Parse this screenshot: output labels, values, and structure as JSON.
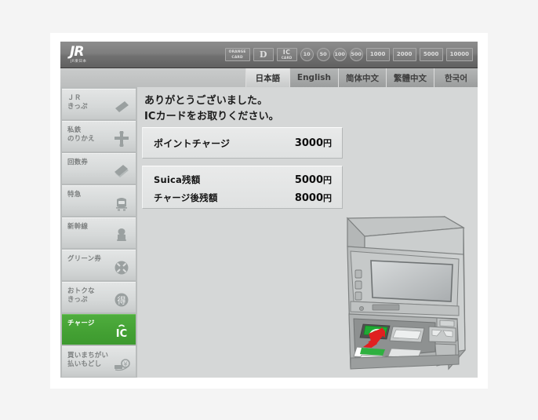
{
  "header": {
    "logo_mark": "JR",
    "logo_sub": "JR東日本",
    "badges": [
      {
        "name": "orange-card",
        "type": "two-line",
        "line1": "ORANGE",
        "line2": "CARD"
      },
      {
        "name": "d-card",
        "type": "dcard",
        "text": "D"
      },
      {
        "name": "ic-card",
        "type": "iccard",
        "line1": "IC",
        "line2": "CARD"
      },
      {
        "name": "coin-10",
        "type": "round",
        "text": "10"
      },
      {
        "name": "coin-50",
        "type": "round",
        "text": "50"
      },
      {
        "name": "coin-100",
        "type": "round",
        "text": "100"
      },
      {
        "name": "coin-500",
        "type": "round",
        "text": "500"
      },
      {
        "name": "note-1000",
        "type": "num",
        "text": "1000"
      },
      {
        "name": "note-2000",
        "type": "num",
        "text": "2000"
      },
      {
        "name": "note-5000",
        "type": "num",
        "text": "5000"
      },
      {
        "name": "note-10000",
        "type": "num",
        "text": "10000"
      }
    ]
  },
  "languages": [
    {
      "label": "日本語",
      "active": true
    },
    {
      "label": "English",
      "active": false
    },
    {
      "label": "简体中文",
      "active": false
    },
    {
      "label": "繁體中文",
      "active": false
    },
    {
      "label": "한국어",
      "active": false
    }
  ],
  "sidebar": {
    "items": [
      {
        "label": "ＪＲ\nきっぷ",
        "icon": "ticket-icon",
        "active": false
      },
      {
        "label": "私鉄\nのりかえ",
        "icon": "transfer-icon",
        "active": false
      },
      {
        "label": "回数券",
        "icon": "coupon-tickets-icon",
        "active": false
      },
      {
        "label": "特急",
        "icon": "limited-express-train-icon",
        "active": false
      },
      {
        "label": "新幹線",
        "icon": "shinkansen-icon",
        "active": false
      },
      {
        "label": "グリーン券",
        "icon": "green-car-icon",
        "active": false
      },
      {
        "label": "おトクな\nきっぷ",
        "icon": "discount-toku-icon",
        "active": false
      },
      {
        "label": "チャージ",
        "icon": "ic-logo-icon",
        "active": true
      },
      {
        "label": "買いまちがい\n払いもどし",
        "icon": "refund-icon",
        "active": false
      }
    ]
  },
  "main": {
    "message_line1": "ありがとうございました。",
    "message_line2": "ICカードをお取りください。",
    "point_charge": {
      "label": "ポイントチャージ",
      "value": "3000",
      "unit": "円"
    },
    "balances": [
      {
        "label": "Suica残額",
        "value": "5000",
        "unit": "円"
      },
      {
        "label": "チャージ後残額",
        "value": "8000",
        "unit": "円"
      }
    ]
  },
  "colors": {
    "accent_green": "#43a033",
    "header_gray": "#7e7e7e",
    "panel_gray": "#d5d7d7",
    "arrow_red": "#e02020"
  },
  "illustration": {
    "name": "ticket-vending-machine",
    "description": "JR ticket vending machine with IC card reader"
  }
}
